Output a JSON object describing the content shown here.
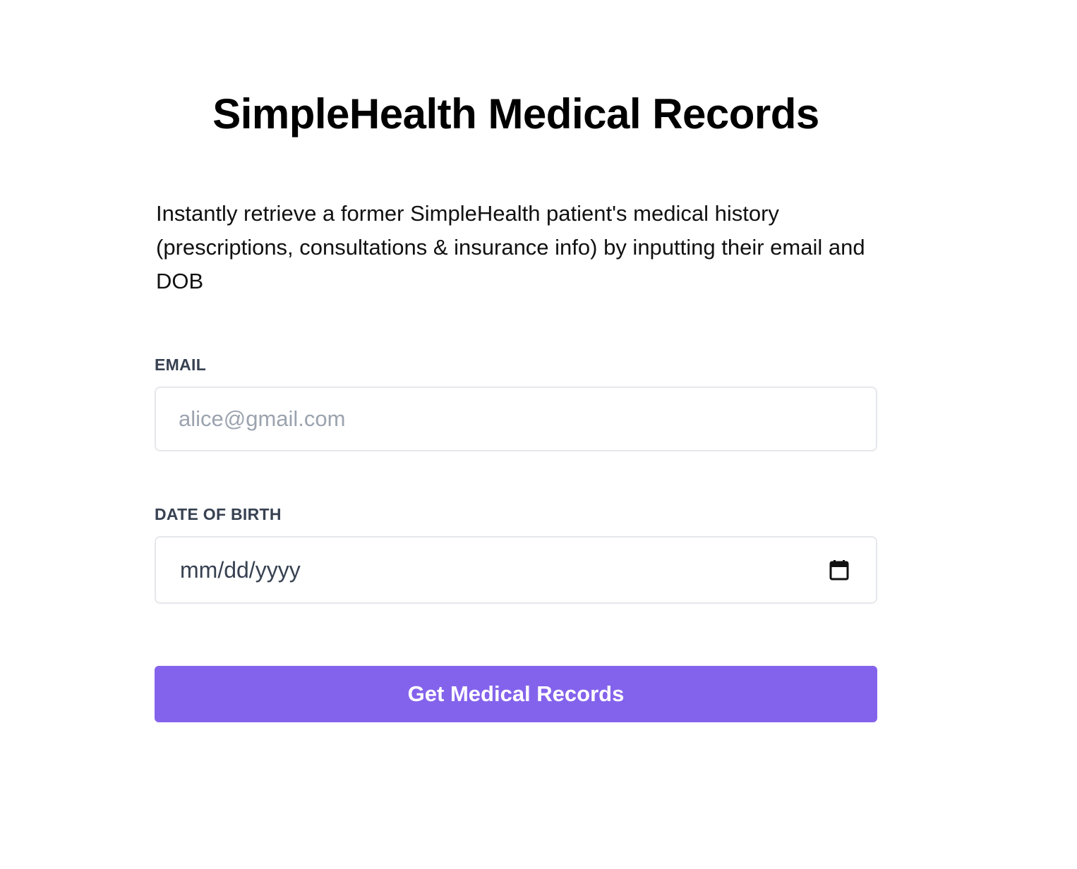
{
  "header": {
    "title": "SimpleHealth Medical Records"
  },
  "main": {
    "description": "Instantly retrieve a former SimpleHealth patient's medical history (prescriptions, consultations & insurance info) by inputting their email and DOB"
  },
  "form": {
    "email_label": "EMAIL",
    "email_placeholder": "alice@gmail.com",
    "email_value": "",
    "dob_label": "DATE OF BIRTH",
    "dob_placeholder": "mm/dd/yyyy",
    "dob_icon": "calendar-icon",
    "submit_label": "Get Medical Records"
  },
  "colors": {
    "accent": "#8463ec",
    "label": "#374151",
    "placeholder": "#9ca3af",
    "border": "#e5e7eb"
  }
}
